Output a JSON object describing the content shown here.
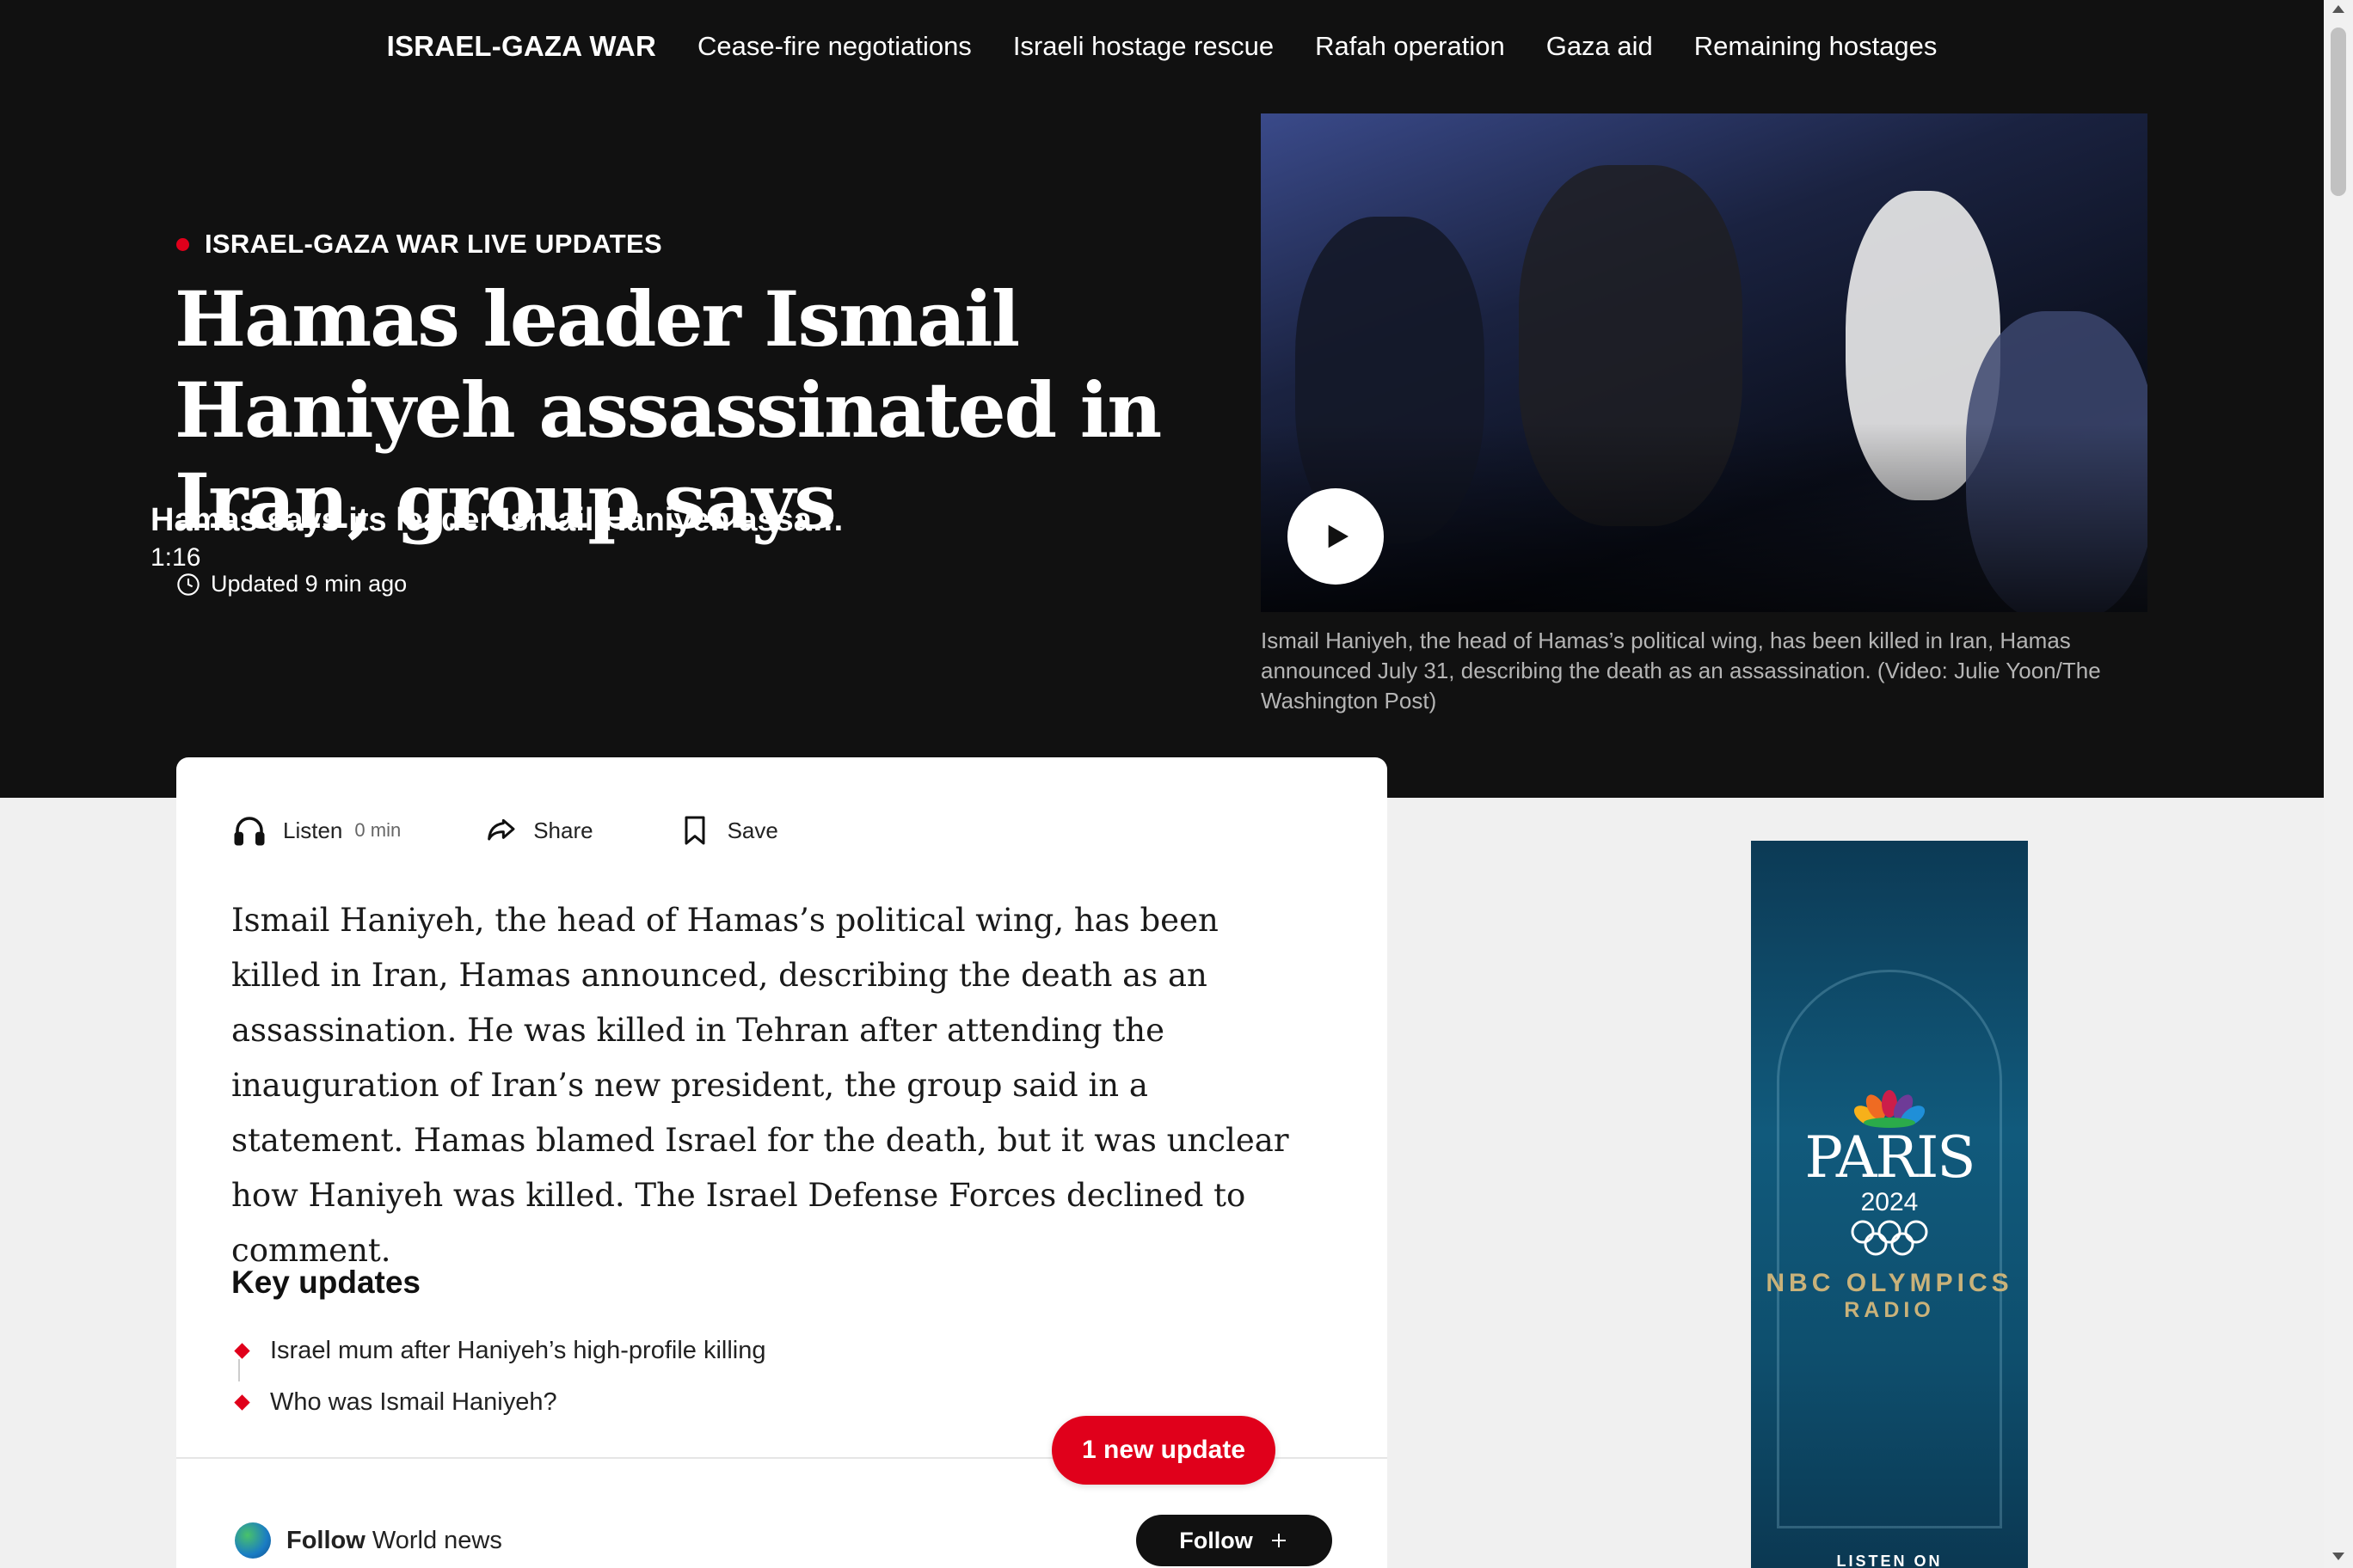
{
  "nav": {
    "brand": "ISRAEL-GAZA WAR",
    "links": [
      "Cease-fire negotiations",
      "Israeli hostage rescue",
      "Rafah operation",
      "Gaza aid",
      "Remaining hostages"
    ]
  },
  "article": {
    "kicker": "ISRAEL-GAZA WAR LIVE UPDATES",
    "headline": "Hamas leader Ismail Haniyeh assassinated in Iran, group says",
    "updated": "Updated 9 min ago",
    "body": "Ismail Haniyeh, the head of Hamas’s political wing, has been killed in Iran, Hamas announced, describing the death as an assassination. He was killed in Tehran after attending the inauguration of Iran’s new president, the group said in a statement. Hamas blamed Israel for the death, but it was unclear how Haniyeh was killed. The Israel Defense Forces declined to comment."
  },
  "video": {
    "title": "Hamas says its leader Ismail Haniyeh assassinated in Iran",
    "duration": "1:16",
    "caption": "Ismail Haniyeh, the head of Hamas’s political wing, has been killed in Iran, Hamas announced July 31, describing the death as an assassination. (Video: Julie Yoon/The Washington Post)"
  },
  "actions": {
    "listen": "Listen",
    "listen_duration": "0 min",
    "share": "Share",
    "save": "Save"
  },
  "key_updates": {
    "title": "Key updates",
    "items": [
      "Israel mum after Haniyeh’s high-profile killing",
      "Who was Ismail Haniyeh?"
    ]
  },
  "new_update_label": "1 new update",
  "follow": {
    "prefix": "Follow",
    "topic": "World news",
    "button_label": "Follow",
    "button_icon": "plus-icon"
  },
  "ad": {
    "city": "PARIS",
    "year": "2024",
    "brand": "NBC OLYMPICS",
    "subbrand": "RADIO",
    "footer": "LISTEN ON"
  },
  "colors": {
    "accent_red": "#e0001b",
    "hero_bg": "#111111",
    "page_bg": "#f0f0f0"
  }
}
